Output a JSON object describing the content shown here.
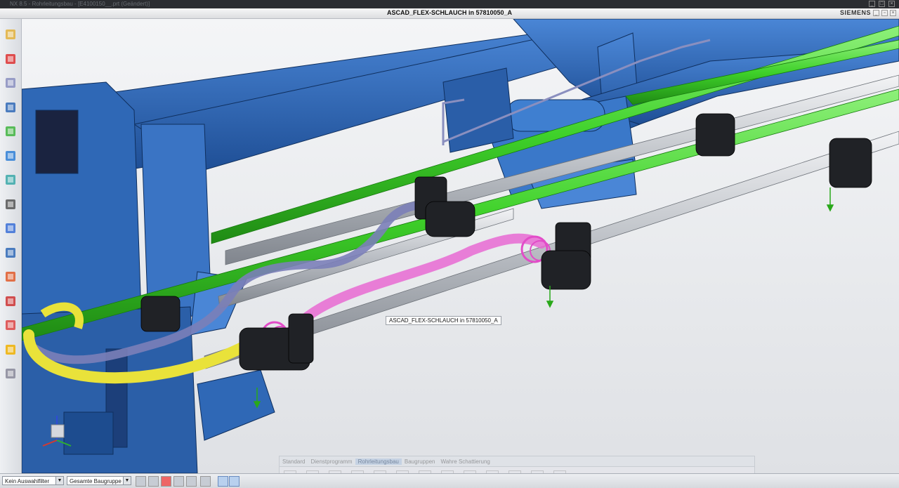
{
  "window": {
    "title": "NX 8.5 - Rohrleitungsbau - [E4100150__.prt (Geändert)]"
  },
  "document": {
    "title": "ASCAD_FLEX-SCHLAUCH in 57810050_A",
    "brand": "SIEMENS"
  },
  "viewport": {
    "tooltip": "ASCAD_FLEX-SCHLAUCH in 57810050_A",
    "triad_label": "Z",
    "colors": {
      "frame": "#2f68b6",
      "frame_dark": "#1d4c8f",
      "hose_green": "#3fd12a",
      "hose_purple": "#7b7fb8",
      "hose_magenta": "#e86ad2",
      "hose_yellow": "#e9e23a",
      "pipe": "#c9ccd1",
      "nozzle": "#202226"
    }
  },
  "left_toolbar": {
    "tools": [
      {
        "name": "assembly-navigator-icon"
      },
      {
        "name": "constraint-navigator-icon"
      },
      {
        "name": "part-navigator-icon"
      },
      {
        "name": "reuse-library-icon"
      },
      {
        "name": "hd3d-tools-icon"
      },
      {
        "name": "web-browser-icon"
      },
      {
        "name": "history-icon"
      },
      {
        "name": "help-icon"
      },
      {
        "name": "clock-icon"
      },
      {
        "name": "list-icon"
      },
      {
        "name": "palette-icon"
      },
      {
        "name": "roles-icon"
      },
      {
        "name": "system-materials-icon"
      },
      {
        "name": "favorites-icon"
      },
      {
        "name": "grid-icon"
      }
    ]
  },
  "floating_toolbar": {
    "tabs": [
      {
        "label": "Standard",
        "active": false
      },
      {
        "label": "Dienstprogramm",
        "active": false
      },
      {
        "label": "Rohrleitungsbau",
        "active": true
      },
      {
        "label": "Baugruppen",
        "active": false
      },
      {
        "label": "Wahre Schattierung",
        "active": false
      }
    ]
  },
  "statusbar": {
    "selection_filter": "Kein Auswahlfilter",
    "scope": "Gesamte Baugruppe"
  }
}
